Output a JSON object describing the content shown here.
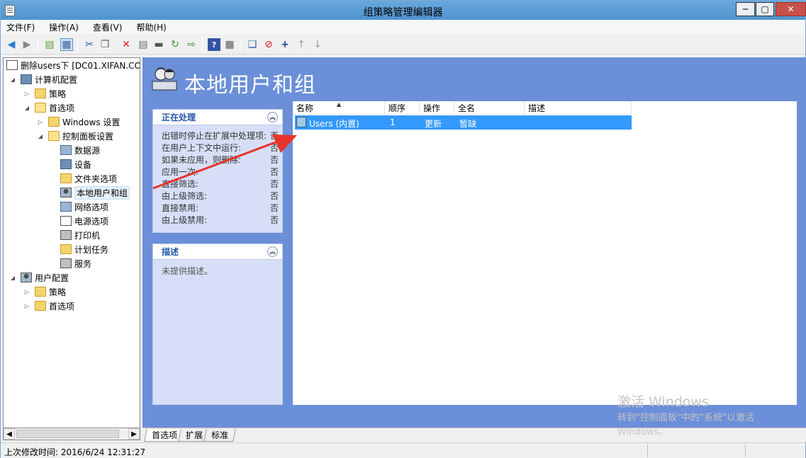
{
  "window": {
    "title": "组策略管理编辑器",
    "controls": {
      "minimize": "─",
      "maximize": "▢",
      "close": "✕"
    }
  },
  "menu": [
    "文件(F)",
    "操作(A)",
    "查看(V)",
    "帮助(H)"
  ],
  "toolbar_icons": [
    "back-icon",
    "forward-icon",
    "up-folder-icon",
    "show-hide-tree-icon",
    "cut-icon",
    "copy-icon",
    "delete-icon",
    "properties-icon",
    "print-icon",
    "refresh-icon",
    "export-icon",
    "help-icon",
    "show-pane-icon",
    "new-item-icon",
    "stop-icon",
    "add-icon",
    "move-up-icon",
    "move-down-icon"
  ],
  "tree": {
    "root": "删除users下 [DC01.XIFAN.CO",
    "computer_config": "计算机配置",
    "policies": "策略",
    "preferences": "首选项",
    "windows_settings": "Windows 设置",
    "control_panel_settings": "控制面板设置",
    "data_sources": "数据源",
    "devices": "设备",
    "folder_options": "文件夹选项",
    "local_users_groups": "本地用户和组",
    "network_options": "网络选项",
    "power_options": "电源选项",
    "printers": "打印机",
    "scheduled_tasks": "计划任务",
    "services": "服务",
    "user_config": "用户配置",
    "user_policies": "策略",
    "user_preferences": "首选项"
  },
  "main": {
    "title": "本地用户和组",
    "processing_panel": {
      "header": "正在处理",
      "rows": [
        {
          "label": "出错时停止在扩展中处理项:",
          "value": "否"
        },
        {
          "label": "在用户上下文中运行:",
          "value": "否"
        },
        {
          "label": "如果未应用，则删除:",
          "value": "否"
        },
        {
          "label": "应用一次:",
          "value": "否"
        },
        {
          "label": "直接筛选:",
          "value": "否"
        },
        {
          "label": "由上级筛选:",
          "value": "否"
        },
        {
          "label": "直接禁用:",
          "value": "否"
        },
        {
          "label": "由上级禁用:",
          "value": "否"
        }
      ]
    },
    "description_panel": {
      "header": "描述",
      "text": "未提供描述。"
    },
    "list": {
      "columns": [
        "名称",
        "顺序",
        "操作",
        "全名",
        "描述"
      ],
      "rows": [
        {
          "name": "Users (内置)",
          "order": "1",
          "action": "更新",
          "fullname": "暂缺",
          "desc": ""
        }
      ]
    }
  },
  "tabs": [
    "首选项",
    "扩展",
    "标准"
  ],
  "status": {
    "text": "上次修改时间: 2016/6/24 12:31:27"
  },
  "watermark": {
    "line1": "激活 Windows",
    "line2": "转到\"控制面板\"中的\"系统\"以激活",
    "line3": "Windows。"
  },
  "colors": {
    "title_bar": "#5b9bd5",
    "main_bg": "#6b8fd8",
    "selection": "#3399ff",
    "panel_header_text": "#2056a8",
    "arrow": "#e8332a"
  }
}
